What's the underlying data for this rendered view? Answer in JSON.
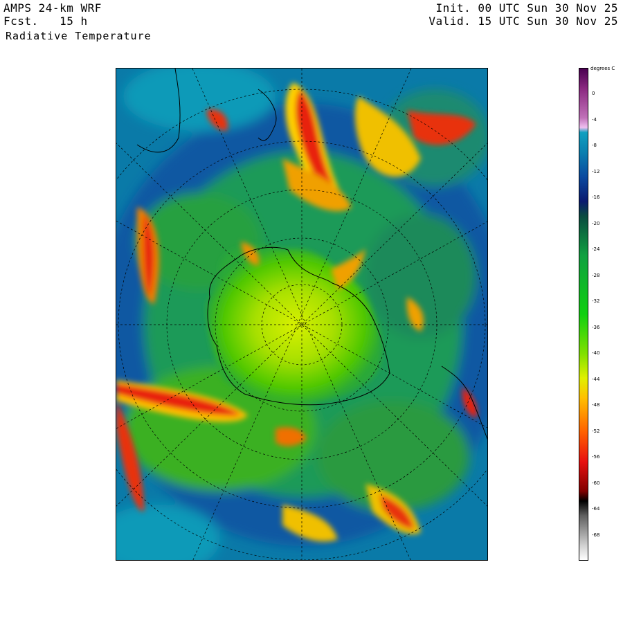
{
  "header": {
    "model": "AMPS 24-km WRF",
    "forecast": "Fcst.   15 h",
    "init": "Init. 00 UTC Sun 30 Nov 25",
    "valid": "Valid. 15 UTC Sun 30 Nov 25",
    "field": "Radiative Temperature"
  },
  "colorbar": {
    "units": "degrees C",
    "tick_labels": [
      "0",
      "-4",
      "-8",
      "-12",
      "-16",
      "-20",
      "-24",
      "-28",
      "-32",
      "-36",
      "-40",
      "-44",
      "-48",
      "-52",
      "-56",
      "-60",
      "-64",
      "-68"
    ],
    "range": [
      4,
      -72
    ]
  },
  "colors": {
    "warm": "#0a5ea0",
    "mid": "#38c010",
    "cold": "#e81010",
    "coldest": "#ffffff"
  }
}
